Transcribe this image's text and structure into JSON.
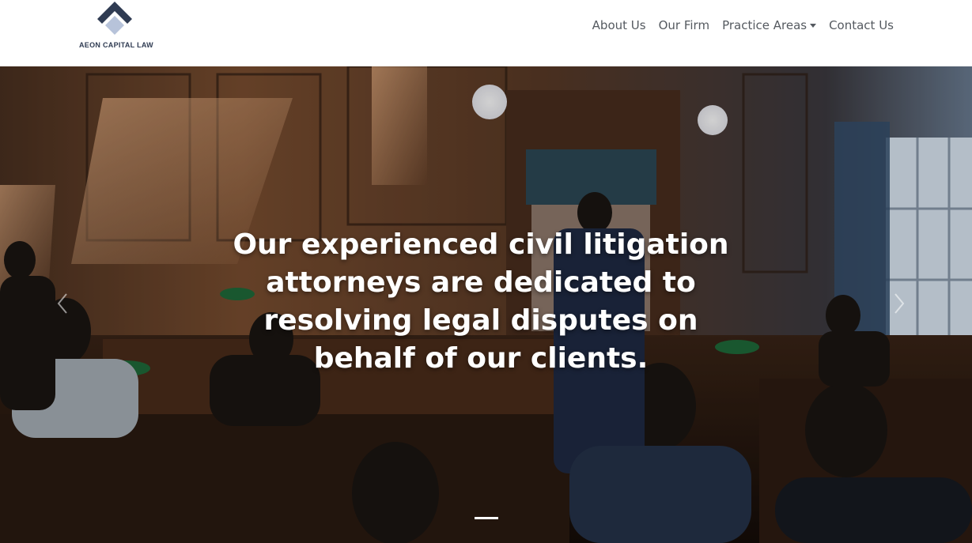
{
  "brand": {
    "name": "AEON CAPITAL LAW"
  },
  "nav": {
    "items": [
      {
        "label": "About Us"
      },
      {
        "label": "Our Firm"
      },
      {
        "label": "Practice Areas",
        "has_dropdown": true
      },
      {
        "label": "Contact Us"
      }
    ]
  },
  "hero": {
    "caption": "Our experienced civil litigation attorneys are dedicated to resolving legal disputes on behalf of our clients.",
    "controls": {
      "prev_icon": "chevron-left-icon",
      "next_icon": "chevron-right-icon"
    },
    "active_slide": 1,
    "slide_count": 1
  },
  "colors": {
    "brand_navy": "#2f3b52",
    "brand_light": "#b7c3da",
    "nav_text": "#555a60",
    "caption_text": "#ffffff"
  }
}
